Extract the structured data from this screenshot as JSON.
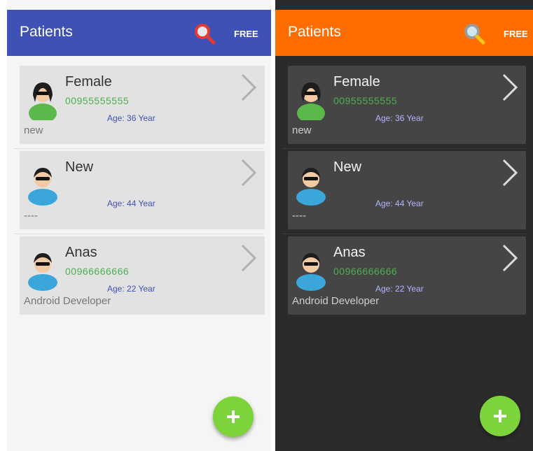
{
  "screens": [
    {
      "theme": "light",
      "appbar": {
        "title": "Patients",
        "free_label": "FREE",
        "color": "#3f51b5",
        "search_icon": "search-icon"
      },
      "patients": [
        {
          "name": "Female",
          "phone": "00955555555",
          "age": "Age: 36 Year",
          "note": "new",
          "avatar": "female-avatar-icon"
        },
        {
          "name": "New",
          "phone": "",
          "age": "Age: 44 Year",
          "note": "----",
          "avatar": "male-avatar-icon"
        },
        {
          "name": "Anas",
          "phone": "00966666666",
          "age": "Age: 22 Year",
          "note": "Android Developer",
          "avatar": "male-avatar-icon"
        }
      ],
      "fab": {
        "icon": "plus-icon",
        "color": "#7dd33c"
      }
    },
    {
      "theme": "dark",
      "appbar": {
        "title": "Patients",
        "free_label": "FREE",
        "color": "#ff6d00",
        "search_icon": "search-icon"
      },
      "patients": [
        {
          "name": "Female",
          "phone": "00955555555",
          "age": "Age: 36 Year",
          "note": "new",
          "avatar": "female-avatar-icon"
        },
        {
          "name": "New",
          "phone": "",
          "age": "Age: 44 Year",
          "note": "----",
          "avatar": "male-avatar-icon"
        },
        {
          "name": "Anas",
          "phone": "00966666666",
          "age": "Age: 22 Year",
          "note": "Android Developer",
          "avatar": "male-avatar-icon"
        }
      ],
      "fab": {
        "icon": "plus-icon",
        "color": "#7dd33c"
      }
    }
  ]
}
